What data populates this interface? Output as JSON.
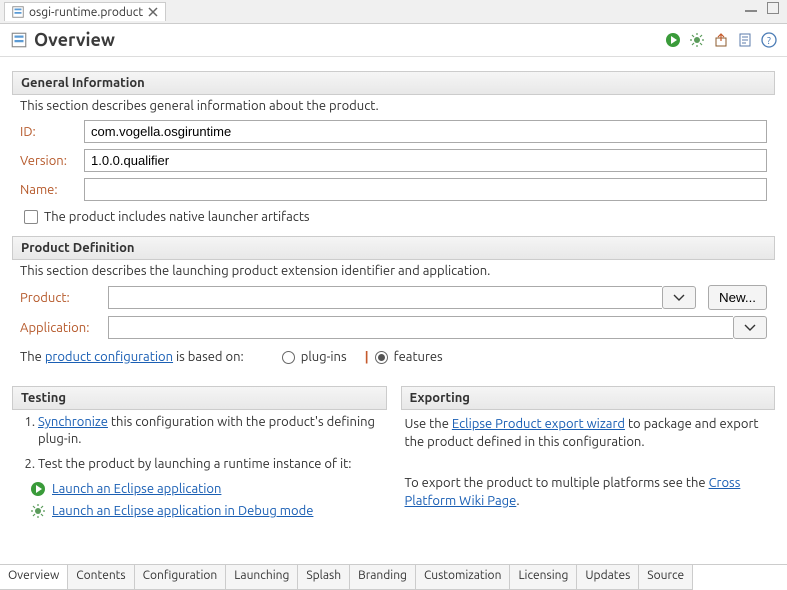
{
  "editor_tab": {
    "title": "osgi-runtime.product"
  },
  "header": {
    "title": "Overview"
  },
  "sections": {
    "general": {
      "title": "General Information",
      "desc": "This section describes general information about the product.",
      "id_label": "ID:",
      "id_value": "com.vogella.osgiruntime",
      "version_label": "Version:",
      "version_value": "1.0.0.qualifier",
      "name_label": "Name:",
      "name_value": "",
      "launcher_checkbox": "The product includes native launcher artifacts"
    },
    "productdef": {
      "title": "Product Definition",
      "desc": "This section describes the launching product extension identifier and application.",
      "product_label": "Product:",
      "product_value": "",
      "application_label": "Application:",
      "application_value": "",
      "new_button": "New...",
      "config_prefix": "The ",
      "config_link": "product configuration",
      "config_suffix": " is based on:",
      "radio_plugins": "plug-ins",
      "radio_features": "features"
    },
    "testing": {
      "title": "Testing",
      "step1_link": "Synchronize",
      "step1_rest": " this configuration with the product's defining plug-in.",
      "step2": "Test the product by launching a runtime instance of it:",
      "launch_run": "Launch an Eclipse application",
      "launch_debug": "Launch an Eclipse application in Debug mode"
    },
    "exporting": {
      "title": "Exporting",
      "p1_prefix": "Use the ",
      "p1_link": "Eclipse Product export wizard",
      "p1_suffix": " to package and export the product defined in this configuration.",
      "p2_prefix": "To export the product to multiple platforms see the ",
      "p2_link": "Cross Platform Wiki Page",
      "p2_suffix": "."
    }
  },
  "bottom_tabs": [
    "Overview",
    "Contents",
    "Configuration",
    "Launching",
    "Splash",
    "Branding",
    "Customization",
    "Licensing",
    "Updates",
    "Source"
  ]
}
